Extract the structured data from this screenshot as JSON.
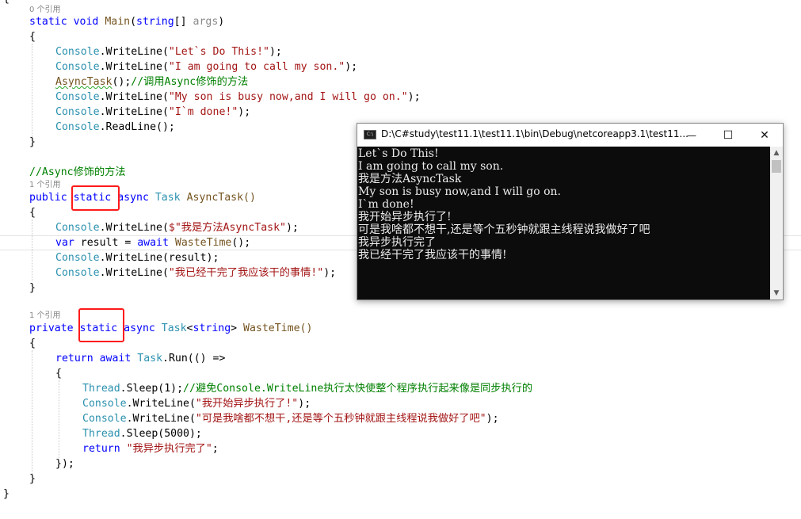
{
  "editor": {
    "refs": {
      "main": "0 个引用",
      "async_task": "1 个引用",
      "waste_time": "1 个引用"
    },
    "code": {
      "top_brace": "{",
      "main_kw_static": "static",
      "main_kw_void": "void",
      "main_name": "Main",
      "main_paren_open": "(",
      "main_param_type": "string",
      "main_param_brackets": "[] ",
      "main_param_name": "args",
      "main_paren_close": ")",
      "main_open": "{",
      "l1_obj": "Console",
      "l1_method": ".WriteLine(",
      "l1_str": "\"Let`s Do This!\"",
      "l1_end": ");",
      "l2_obj": "Console",
      "l2_method": ".WriteLine(",
      "l2_str": "\"I am going to call my son.\"",
      "l2_end": ");",
      "l3_call": "AsyncTask",
      "l3_end": "();",
      "l3_comment": "//调用Async修饰的方法",
      "l4_obj": "Console",
      "l4_method": ".WriteLine(",
      "l4_str": "\"My son is busy now,and I will go on.\"",
      "l4_end": ");",
      "l5_obj": "Console",
      "l5_method": ".WriteLine(",
      "l5_str": "\"I`m done!\"",
      "l5_end": ");",
      "l6_obj": "Console",
      "l6_method": ".ReadLine();",
      "main_close": "}",
      "comment_async": "//Async修饰的方法",
      "at_public": "public",
      "at_static": "static",
      "at_async": "async",
      "at_task": "Task",
      "at_name": "AsyncTask()",
      "at_open": "{",
      "at1_obj": "Console",
      "at1_method": ".WriteLine(",
      "at1_str": "$\"我是方法AsyncTask\"",
      "at1_end": ");",
      "at2_var": "var",
      "at2_mid": " result = ",
      "at2_await": "await",
      "at2_call": "WasteTime",
      "at2_end": "();",
      "at3_obj": "Console",
      "at3_method": ".WriteLine(result);",
      "at4_obj": "Console",
      "at4_method": ".WriteLine(",
      "at4_str": "\"我已经干完了我应该干的事情!\"",
      "at4_end": ");",
      "at_close": "}",
      "wt_private": "private",
      "wt_static": "static",
      "wt_async": "async",
      "wt_task": "Task",
      "wt_lt": "<",
      "wt_string": "string",
      "wt_gt": ">",
      "wt_name": "WasteTime()",
      "wt_open": "{",
      "wt_return": "return",
      "wt_await": "await",
      "wt_task2": "Task",
      "wt_run": ".Run(() =>",
      "lam_open": "{",
      "t1_obj": "Thread",
      "t1_method": ".Sleep(1);",
      "t1_comment": "//避免Console.WriteLine执行太快使整个程序执行起来像是同步执行的",
      "t2_obj": "Console",
      "t2_method": ".WriteLine(",
      "t2_str": "\"我开始异步执行了!\"",
      "t2_end": ");",
      "t3_obj": "Console",
      "t3_method": ".WriteLine(",
      "t3_str": "\"可是我啥都不想干,还是等个五秒钟就跟主线程说我做好了吧\"",
      "t3_end": ");",
      "t4_obj": "Thread",
      "t4_method": ".Sleep(5000);",
      "t5_return": "return",
      "t5_str": "\"我异步执行完了\"",
      "t5_end": ";",
      "lam_close": "});",
      "wt_close": "}",
      "class_close": "}"
    }
  },
  "console": {
    "title": "D:\\C#study\\test11.1\\test11.1\\bin\\Debug\\netcoreapp3.1\\test11...",
    "icon_label": "C:\\",
    "minimize": "—",
    "maximize": "☐",
    "close": "✕",
    "output": [
      "Let`s Do This!",
      "I am going to call my son.",
      "我是方法AsyncTask",
      "My son is busy now,and I will go on.",
      "I`m done!",
      "我开始异步执行了!",
      "可是我啥都不想干,还是等个五秒钟就跟主线程说我做好了吧",
      "我异步执行完了",
      "我已经干完了我应该干的事情!"
    ]
  },
  "colors": {
    "keyword": "#0000ff",
    "type": "#2b91af",
    "string": "#a31515",
    "comment": "#008000",
    "highlight_box": "#ff1a1a",
    "console_bg": "#0c0c0c"
  }
}
